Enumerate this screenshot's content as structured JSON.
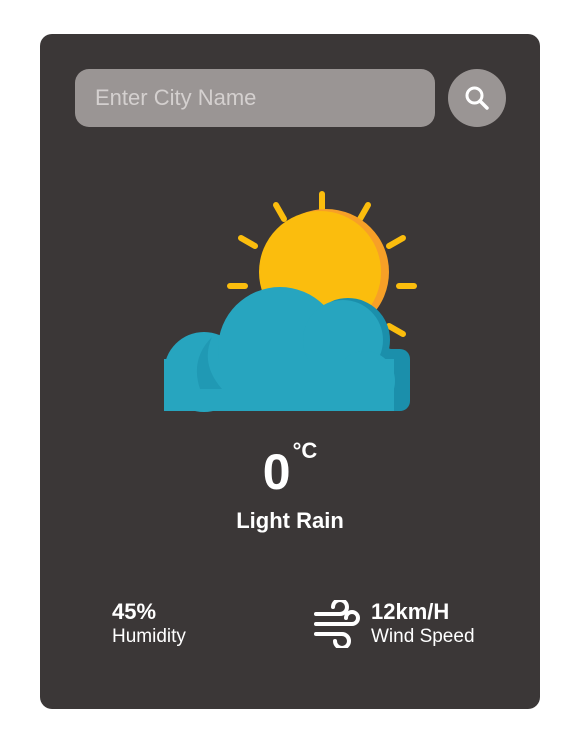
{
  "search": {
    "placeholder": "Enter City Name",
    "button_icon": "search-icon"
  },
  "weather": {
    "icon": "sun-behind-cloud-icon",
    "temperature": "0",
    "unit": "°C",
    "condition": "Light Rain"
  },
  "details": {
    "humidity": {
      "value": "45%",
      "label": "Humidity"
    },
    "wind": {
      "value": "12km/H",
      "label": "Wind Speed",
      "icon": "wind-icon"
    }
  },
  "colors": {
    "card_background": "#3b3737",
    "input_background": "#9a9594",
    "sun": "#fbbd0d",
    "sun_shade": "#f7a027",
    "cloud": "#27a5bf",
    "cloud_shade": "#1b8fab"
  }
}
